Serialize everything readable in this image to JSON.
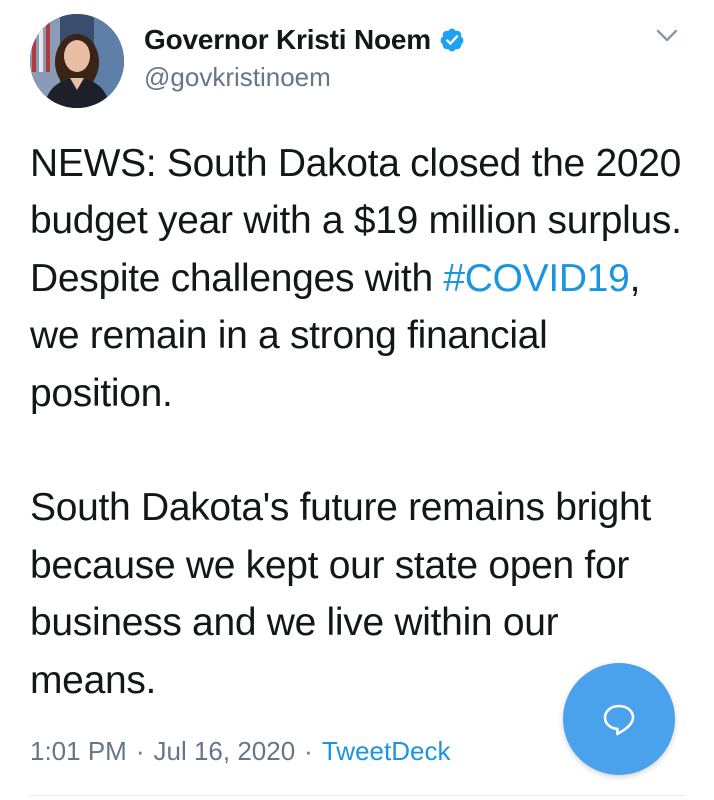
{
  "header": {
    "display_name": "Governor Kristi Noem",
    "handle": "@govkristinoem",
    "verified": true,
    "verified_icon": "verified-badge-icon",
    "more_icon": "chevron-down-icon"
  },
  "tweet": {
    "p1_before": "NEWS: South Dakota closed the 2020 budget year with a $19 million surplus. Despite challenges with ",
    "hashtag": "#COVID19",
    "p1_after": ", we remain in a strong financial position.",
    "p2": "South Dakota's future remains bright because we kept our state open for business and we live within our means."
  },
  "meta": {
    "time": "1:01 PM",
    "date": "Jul 16, 2020",
    "source": "TweetDeck",
    "separator": "·"
  },
  "fab": {
    "icon": "reply-bubble-icon"
  },
  "colors": {
    "text": "#14171a",
    "secondary": "#657786",
    "link": "#1b95e0",
    "fab": "#4aa1ec",
    "verified": "#1da1f2"
  }
}
